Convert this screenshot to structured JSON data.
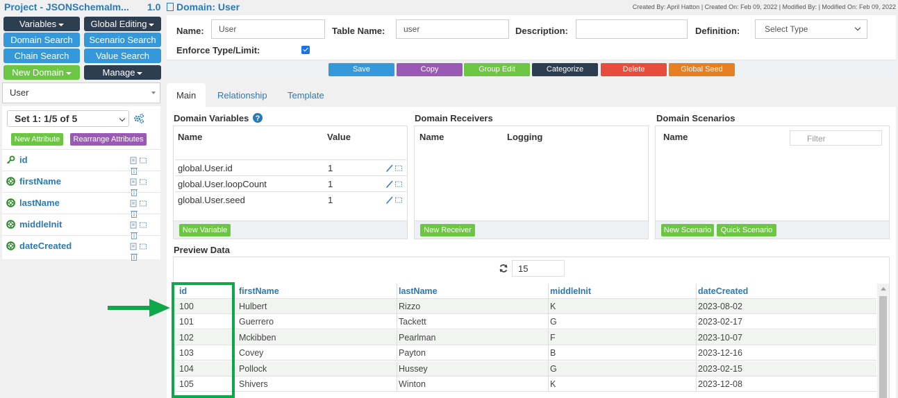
{
  "project": {
    "title": "Project - JSONSchemaIm...",
    "version": "1.0"
  },
  "sidebar": {
    "buttons": {
      "variables": "Variables",
      "global_editing": "Global Editing",
      "domain_search": "Domain Search",
      "scenario_search": "Scenario Search",
      "chain_search": "Chain Search",
      "value_search": "Value Search",
      "new_domain": "New Domain",
      "manage": "Manage"
    },
    "domain_select": "User",
    "set_select": "Set 1: 1/5 of 5",
    "new_attribute": "New Attribute",
    "rearrange_attributes": "Rearrange Attributes",
    "attributes": [
      {
        "name": "id",
        "icon": "key-icon"
      },
      {
        "name": "firstName",
        "icon": "lifebuoy-icon"
      },
      {
        "name": "lastName",
        "icon": "lifebuoy-icon"
      },
      {
        "name": "middleInit",
        "icon": "lifebuoy-icon"
      },
      {
        "name": "dateCreated",
        "icon": "lifebuoy-icon"
      }
    ]
  },
  "header": {
    "domain_title": "Domain: User",
    "meta": "Created By: April Hatton | Created On: Feb 09, 2022 | Modified By: | Modified On: Feb 09, 2022"
  },
  "form": {
    "name_label": "Name:",
    "name_value": "User",
    "table_name_label": "Table Name:",
    "table_name_value": "user",
    "description_label": "Description:",
    "description_value": "",
    "definition_label": "Definition:",
    "definition_value": "Select Type",
    "enforce_label": "Enforce Type/Limit:",
    "enforce_checked": true
  },
  "actions": {
    "save": "Save",
    "copy": "Copy",
    "group_edit": "Group Edit",
    "categorize": "Categorize",
    "delete": "Delete",
    "global_seed": "Global Seed"
  },
  "tabs": [
    "Main",
    "Relationship",
    "Template"
  ],
  "variables": {
    "title": "Domain Variables",
    "col_name": "Name",
    "col_value": "Value",
    "rows": [
      {
        "name": "global.User.id",
        "value": "1"
      },
      {
        "name": "global.User.loopCount",
        "value": "1"
      },
      {
        "name": "global.User.seed",
        "value": "1"
      }
    ],
    "new_button": "New Variable"
  },
  "receivers": {
    "title": "Domain Receivers",
    "col_name": "Name",
    "col_logging": "Logging",
    "new_button": "New Receiver"
  },
  "scenarios": {
    "title": "Domain Scenarios",
    "col_name": "Name",
    "filter_placeholder": "Filter",
    "new_button": "New Scenario",
    "quick_button": "Quick Scenario"
  },
  "preview": {
    "title": "Preview Data",
    "row_count": "15",
    "columns": [
      "id",
      "firstName",
      "lastName",
      "middleInit",
      "dateCreated"
    ],
    "rows": [
      [
        "100",
        "Hulbert",
        "Rizzo",
        "K",
        "2023-08-02"
      ],
      [
        "101",
        "Guerrero",
        "Tackett",
        "G",
        "2023-02-17"
      ],
      [
        "102",
        "Mckibben",
        "Pearlman",
        "F",
        "2023-10-07"
      ],
      [
        "103",
        "Covey",
        "Payton",
        "B",
        "2023-12-16"
      ],
      [
        "104",
        "Pollock",
        "Hussey",
        "G",
        "2023-02-15"
      ],
      [
        "105",
        "Shivers",
        "Winton",
        "K",
        "2023-12-08"
      ]
    ]
  },
  "colors": {
    "brand_blue": "#2a7ab8",
    "dark": "#2c3e50",
    "button_blue": "#3498db",
    "green": "#6cc644",
    "purple": "#9b59b6",
    "red": "#e74c3c",
    "orange": "#e67e22",
    "annotation_green": "#0ea84a"
  }
}
